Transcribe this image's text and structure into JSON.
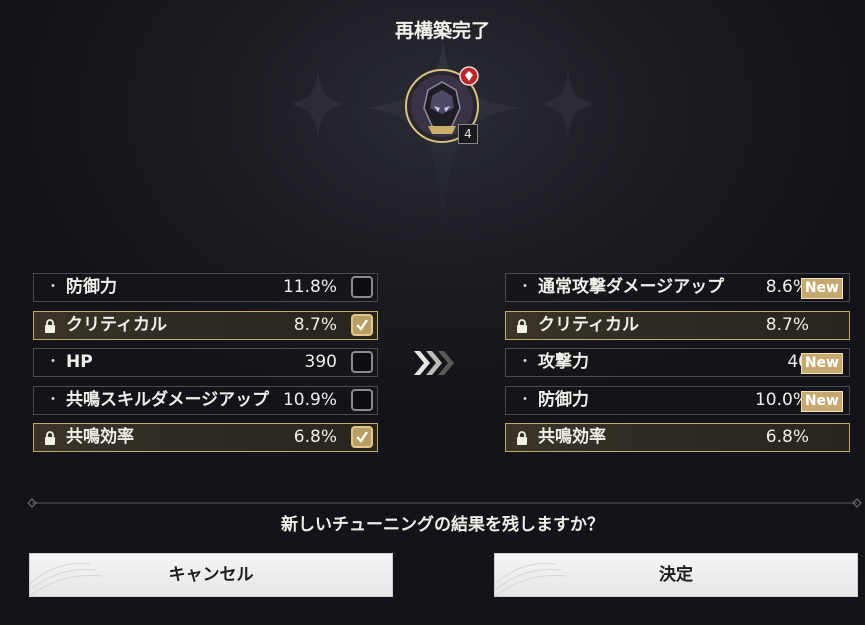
{
  "title": "再構築完了",
  "echo": {
    "icon": "echo-mask-icon",
    "badge_icon": "rarity-badge-icon",
    "level": "4"
  },
  "before": {
    "rows": [
      {
        "name": "防御力",
        "value": "11.8%",
        "locked": false,
        "checked": false
      },
      {
        "name": "クリティカル",
        "value": "8.7%",
        "locked": true,
        "checked": true
      },
      {
        "name": "HP",
        "value": "390",
        "locked": false,
        "checked": false
      },
      {
        "name": "共鳴スキルダメージアップ",
        "value": "10.9%",
        "locked": false,
        "checked": false
      },
      {
        "name": "共鳴効率",
        "value": "6.8%",
        "locked": true,
        "checked": true
      }
    ]
  },
  "after": {
    "rows": [
      {
        "name": "通常攻撃ダメージアップ",
        "value": "8.6%",
        "locked": false,
        "new": "New"
      },
      {
        "name": "クリティカル",
        "value": "8.7%",
        "locked": true,
        "new": ""
      },
      {
        "name": "攻撃力",
        "value": "40",
        "locked": false,
        "new": "New"
      },
      {
        "name": "防御力",
        "value": "10.0%",
        "locked": false,
        "new": "New"
      },
      {
        "name": "共鳴効率",
        "value": "6.8%",
        "locked": true,
        "new": ""
      }
    ]
  },
  "bullet": "・",
  "question": "新しいチューニングの結果を残しますか？",
  "buttons": {
    "cancel": "キャンセル",
    "confirm": "決定"
  },
  "colors": {
    "gold": "#c6a970",
    "lockedBorder": "#c7a86b",
    "buttonBg": "#f0f0f0"
  }
}
